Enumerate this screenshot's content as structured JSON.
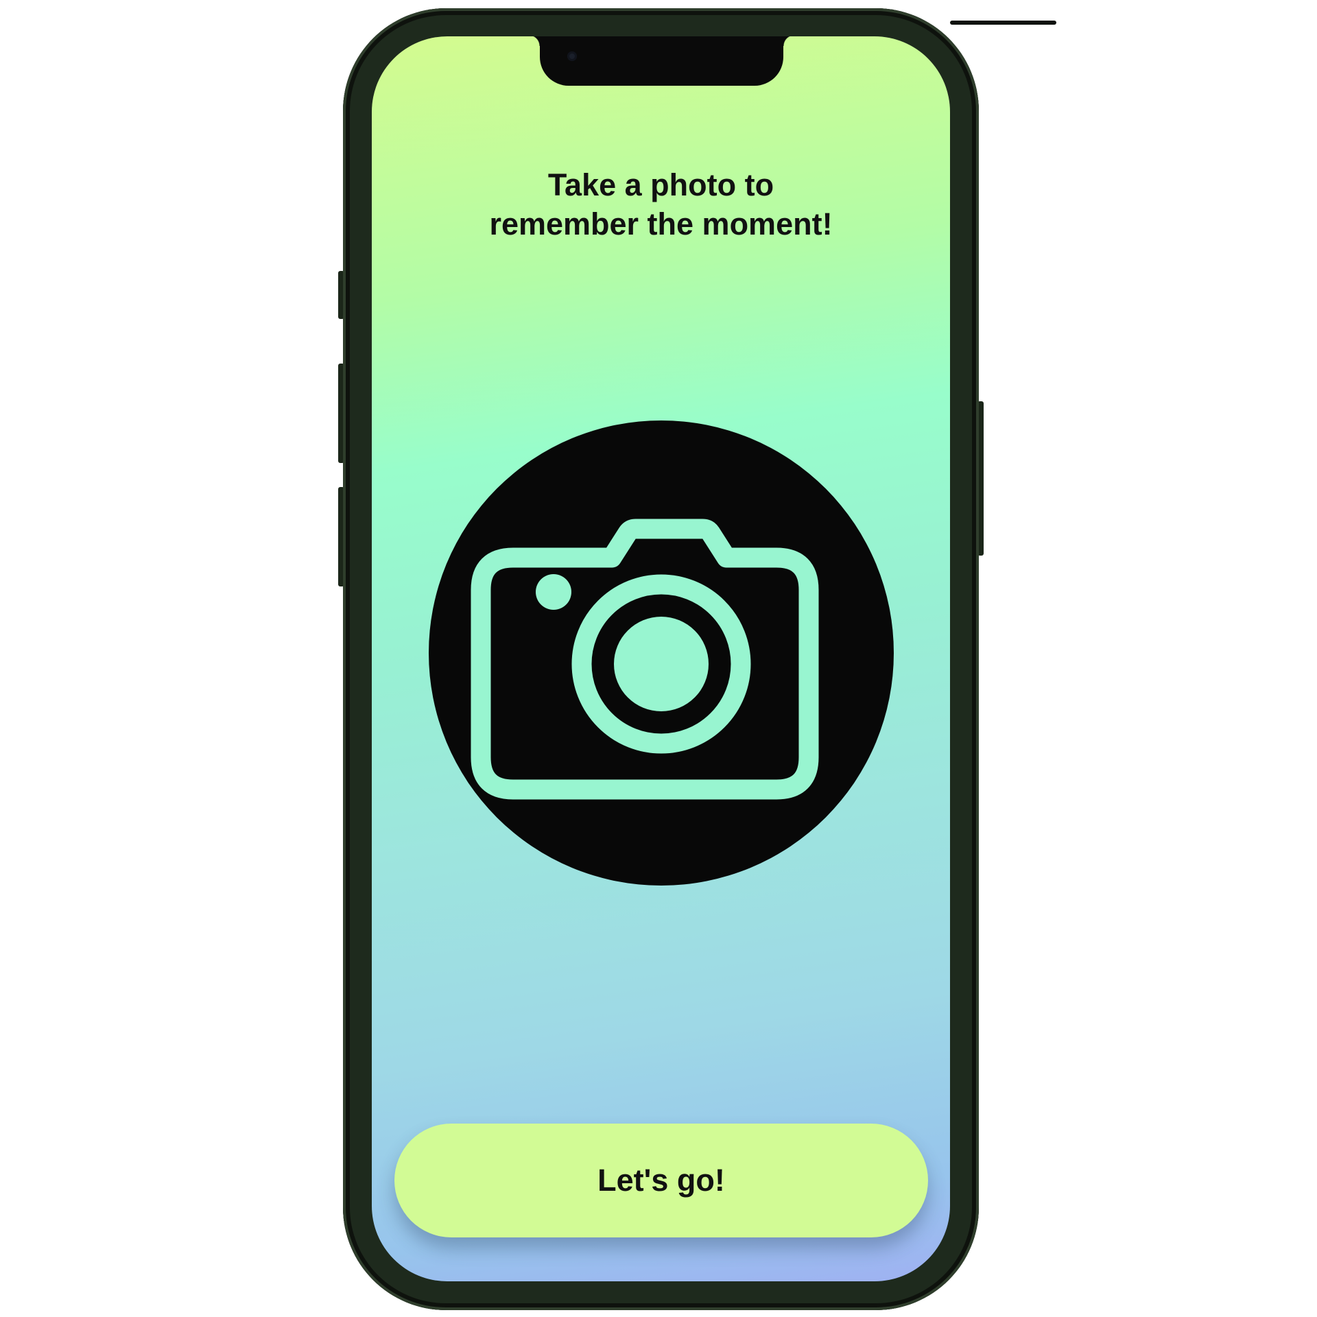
{
  "screen": {
    "headline_line1": "Take a photo to",
    "headline_line2": "remember the moment!",
    "illustration_icon": "camera-icon",
    "cta_label": "Let's go!"
  },
  "colors": {
    "gradient_top": "#d4fb8f",
    "gradient_mid": "#98fdcb",
    "gradient_bottom": "#9fb1f2",
    "icon_circle": "#080808",
    "icon_stroke": "#98f5d0",
    "button_bg": "#d2fb95",
    "text": "#111111",
    "phone_frame": "#1e2a1d"
  }
}
